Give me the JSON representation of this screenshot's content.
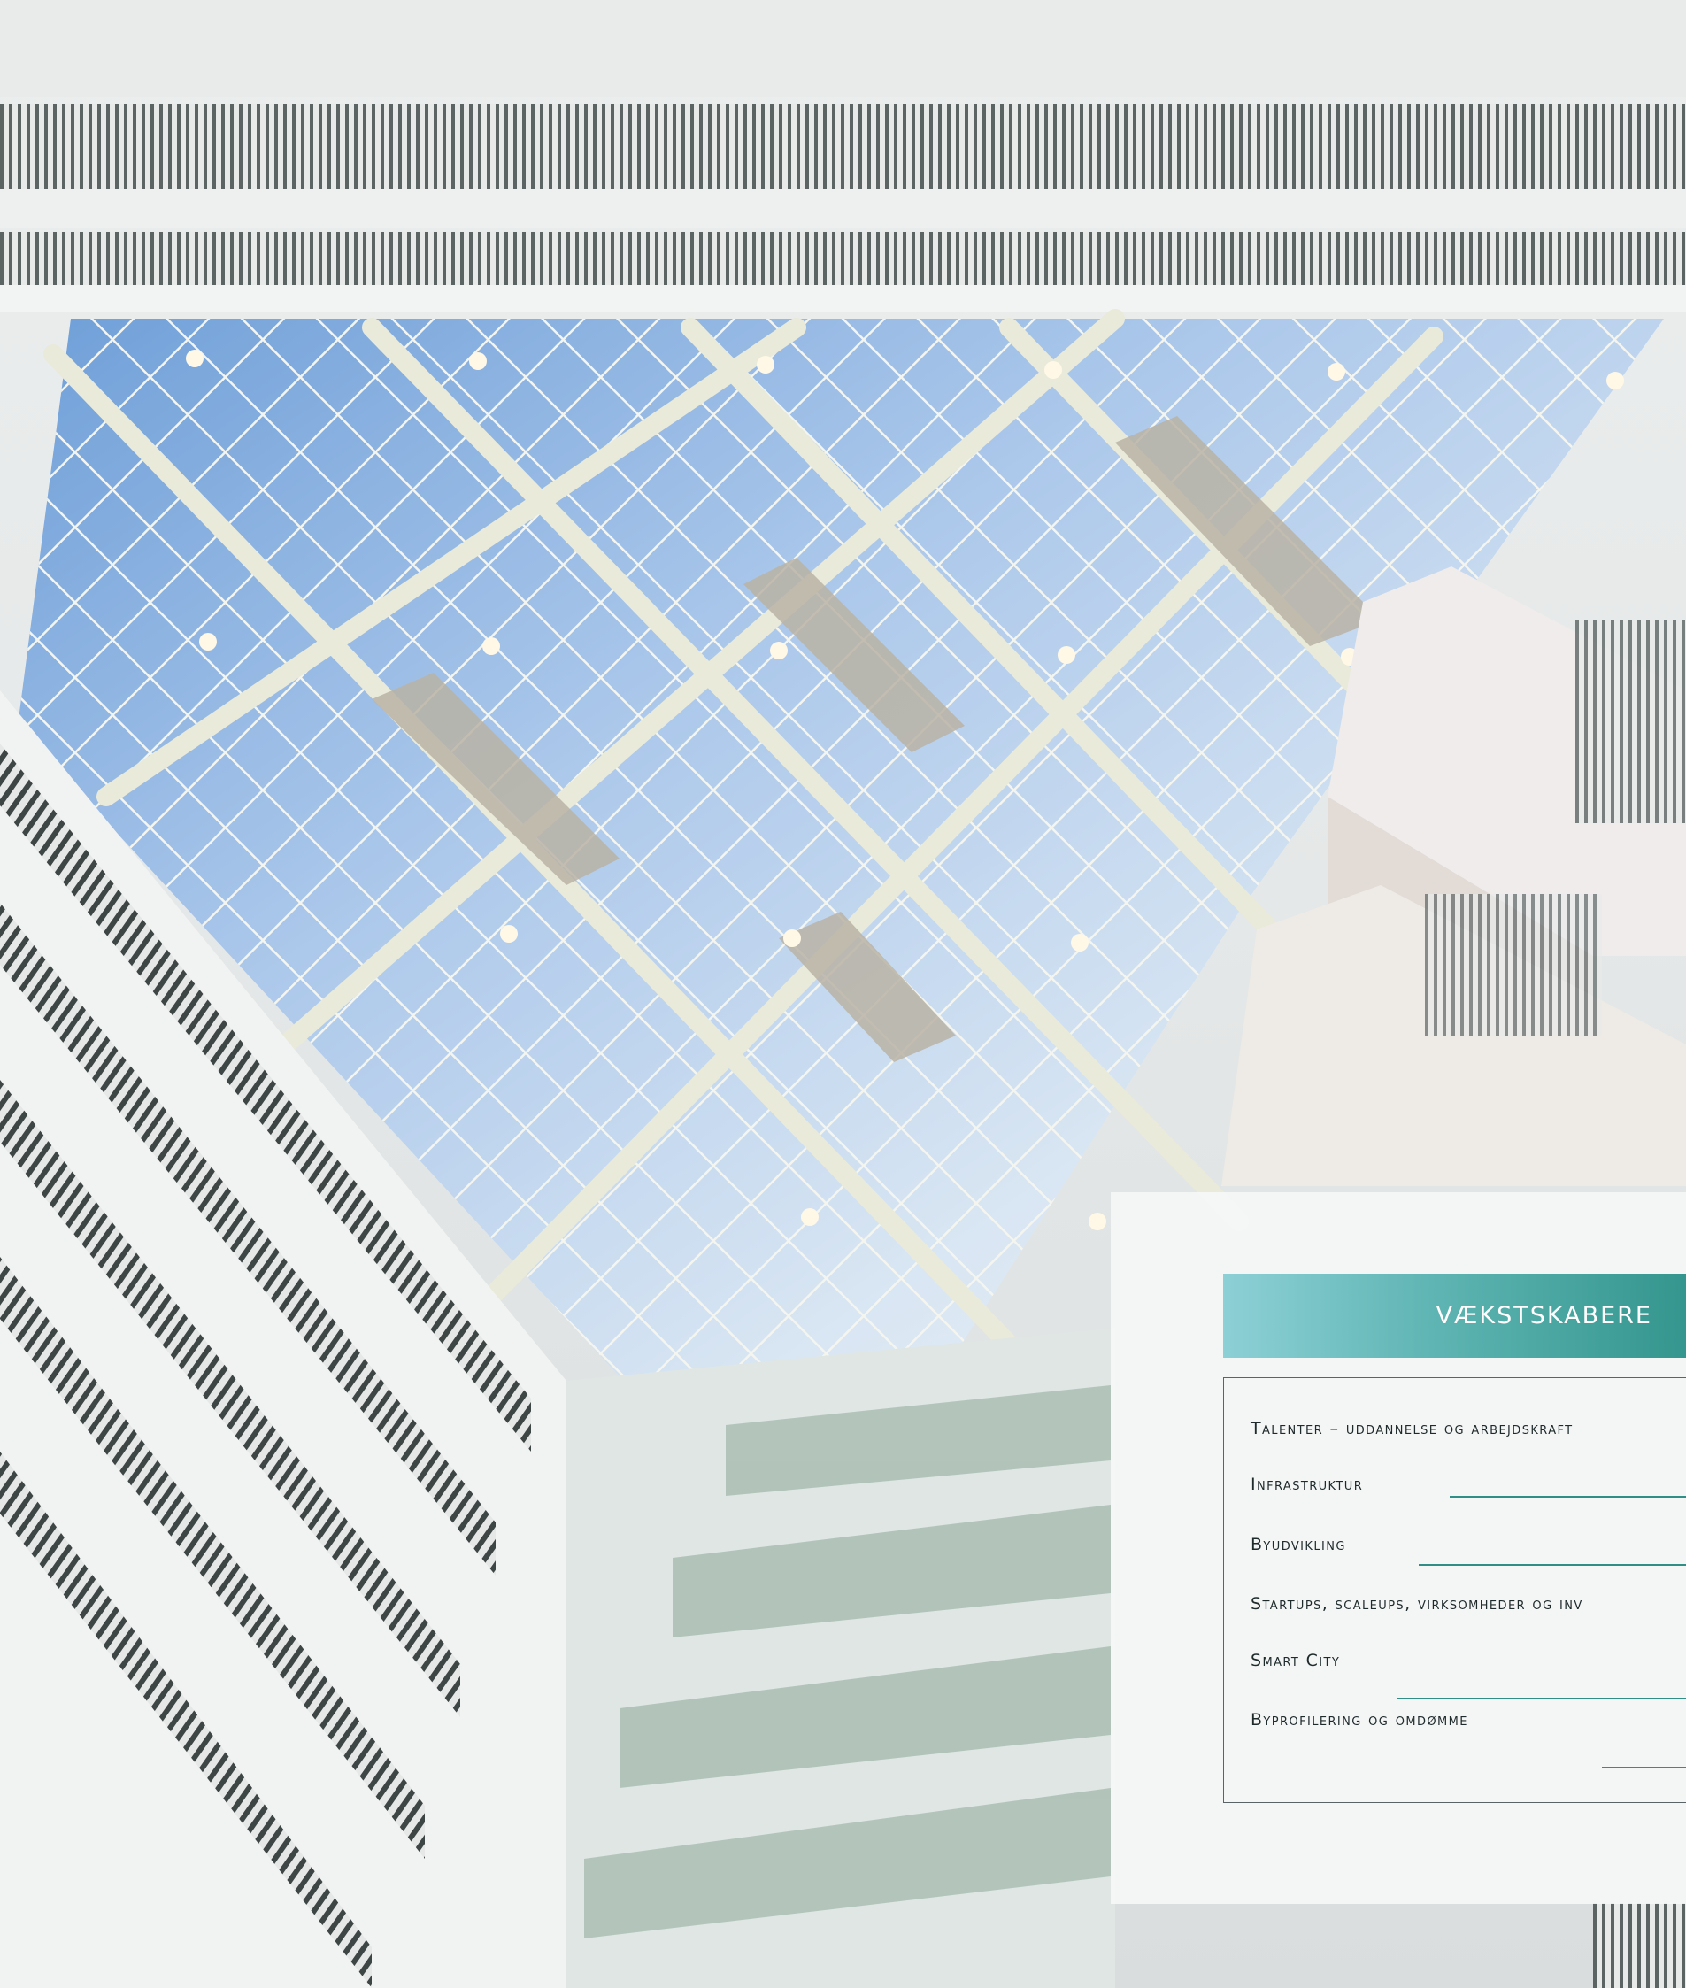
{
  "panel": {
    "title": "VÆKSTSKABERE",
    "items": [
      {
        "label": "Talenter – uddannelse og arbejdskraft"
      },
      {
        "label": "Infrastruktur"
      },
      {
        "label": "Byudvikling"
      },
      {
        "label": "Startups, scaleups, virksomheder og inv"
      },
      {
        "label": "Smart City"
      },
      {
        "label": "Byprofilering og omdømme"
      }
    ]
  },
  "colors": {
    "ribbon_start": "#8dd0d6",
    "ribbon_end": "#34968e",
    "rule": "#2f8f86",
    "text": "#1f2a2b"
  }
}
